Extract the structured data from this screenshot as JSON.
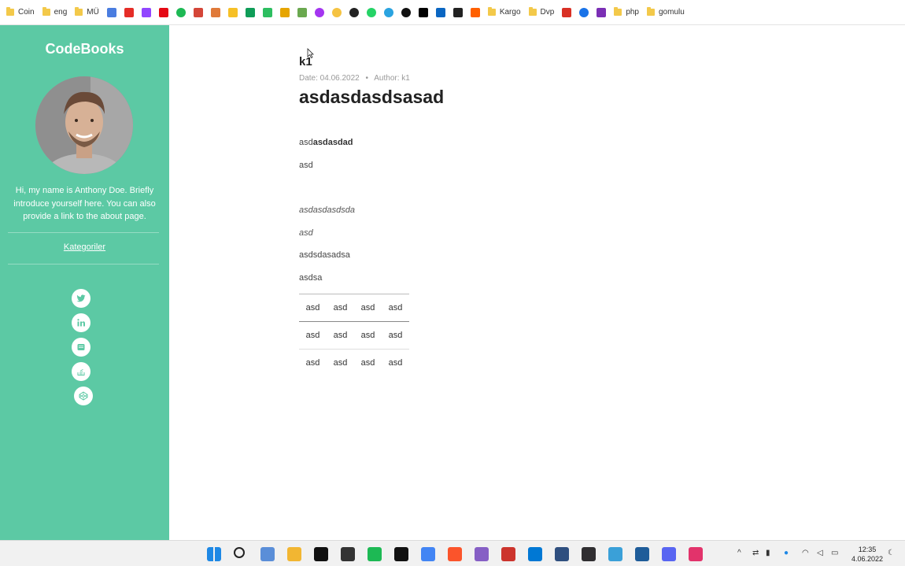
{
  "bookmarks": [
    {
      "label": "Coin",
      "type": "folder"
    },
    {
      "label": "eng",
      "type": "folder"
    },
    {
      "label": "MÜ",
      "type": "folder"
    },
    {
      "label": "",
      "type": "icon",
      "icon": "translate-icon",
      "color": "#4a7de0"
    },
    {
      "label": "",
      "type": "icon",
      "icon": "youtube-icon",
      "color": "#e52d27"
    },
    {
      "label": "",
      "type": "icon",
      "icon": "twitch-icon",
      "color": "#9146ff"
    },
    {
      "label": "",
      "type": "icon",
      "icon": "netflix-icon",
      "color": "#e50914"
    },
    {
      "label": "",
      "type": "icon",
      "icon": "spotify-icon",
      "color": "#1db954"
    },
    {
      "label": "",
      "type": "icon",
      "icon": "gmail-icon",
      "color": "#d44638"
    },
    {
      "label": "",
      "type": "icon",
      "icon": "bookmark-icon",
      "color": "#e07a3a"
    },
    {
      "label": "",
      "type": "icon",
      "icon": "keep-icon",
      "color": "#f6c026"
    },
    {
      "label": "",
      "type": "icon",
      "icon": "sheets-icon",
      "color": "#0f9d58"
    },
    {
      "label": "",
      "type": "icon",
      "icon": "evernote-icon",
      "color": "#2dbe60"
    },
    {
      "label": "",
      "type": "icon",
      "icon": "app-icon",
      "color": "#e6a500"
    },
    {
      "label": "",
      "type": "icon",
      "icon": "photos-icon",
      "color": "#6aa84f"
    },
    {
      "label": "",
      "type": "icon",
      "icon": "udemy-icon",
      "color": "#a435f0"
    },
    {
      "label": "",
      "type": "icon",
      "icon": "circle-icon",
      "color": "#f5c342"
    },
    {
      "label": "",
      "type": "icon",
      "icon": "github-icon",
      "color": "#222222"
    },
    {
      "label": "",
      "type": "icon",
      "icon": "whatsapp-icon",
      "color": "#25d366"
    },
    {
      "label": "",
      "type": "icon",
      "icon": "telegram-icon",
      "color": "#2aa3e0"
    },
    {
      "label": "",
      "type": "icon",
      "icon": "threads-icon",
      "color": "#111111"
    },
    {
      "label": "",
      "type": "icon",
      "icon": "medium-icon",
      "color": "#000000"
    },
    {
      "label": "",
      "type": "icon",
      "icon": "linkedin-icon",
      "color": "#0a66c2"
    },
    {
      "label": "",
      "type": "icon",
      "icon": "amazon-icon",
      "color": "#222222"
    },
    {
      "label": "",
      "type": "icon",
      "icon": "hepsiburada-icon",
      "color": "#ff6000"
    },
    {
      "label": "Kargo",
      "type": "folder"
    },
    {
      "label": "Dvp",
      "type": "folder"
    },
    {
      "label": "",
      "type": "icon",
      "icon": "gmail-red-icon",
      "color": "#d93025"
    },
    {
      "label": "",
      "type": "icon",
      "icon": "play-icon",
      "color": "#1a73e8"
    },
    {
      "label": "",
      "type": "icon",
      "icon": "k-icon",
      "color": "#7b2fb5"
    },
    {
      "label": "php",
      "type": "folder"
    },
    {
      "label": "gomulu",
      "type": "folder"
    }
  ],
  "sidebar": {
    "brand": "CodeBooks",
    "intro": "Hi, my name is Anthony Doe. Briefly introduce yourself here. You can also provide a link to the about page.",
    "category_link": "Kategoriler",
    "accent": "#5cc9a4",
    "social": [
      {
        "name": "twitter-icon"
      },
      {
        "name": "linkedin-icon"
      },
      {
        "name": "github-icon"
      },
      {
        "name": "stack-overflow-icon"
      },
      {
        "name": "codepen-icon"
      }
    ]
  },
  "post": {
    "author_heading": "k1",
    "meta_date": "Date: 04.06.2022",
    "meta_sep": "•",
    "meta_author": "Author: k1",
    "title": "asdasdasdsasad",
    "p1_plain": "asd",
    "p1_bold": "asdasdad",
    "p2": "asd",
    "p3_plain": "asd",
    "p3_italic": "asdasdsda",
    "p4_italic": "asd",
    "p5": "asdsdasadsa",
    "p6": "asdsa",
    "table": [
      [
        "asd",
        "asd",
        "asd",
        "asd"
      ],
      [
        "asd",
        "asd",
        "asd",
        "asd"
      ],
      [
        "asd",
        "asd",
        "asd",
        "asd"
      ]
    ]
  },
  "taskbar": {
    "icons": [
      {
        "name": "windows-start-icon",
        "color": "#1e88e5"
      },
      {
        "name": "search-icon",
        "color": "#222222"
      },
      {
        "name": "widgets-icon",
        "color": "#5a8ed8"
      },
      {
        "name": "file-explorer-icon",
        "color": "#f2b632"
      },
      {
        "name": "terminal-icon",
        "color": "#111111"
      },
      {
        "name": "media-player-icon",
        "color": "#333333"
      },
      {
        "name": "spotify-icon",
        "color": "#1db954"
      },
      {
        "name": "notion-icon",
        "color": "#111111"
      },
      {
        "name": "chrome-icon",
        "color": "#4285f4"
      },
      {
        "name": "brave-icon",
        "color": "#fb542b"
      },
      {
        "name": "visual-studio-icon",
        "color": "#865fc5"
      },
      {
        "name": "ruby-icon",
        "color": "#cc342d"
      },
      {
        "name": "vscode-icon",
        "color": "#0078d4"
      },
      {
        "name": "dev-icon",
        "color": "#2f4f7f"
      },
      {
        "name": "obs-icon",
        "color": "#302e31"
      },
      {
        "name": "snipping-icon",
        "color": "#3aa0d8"
      },
      {
        "name": "virtualbox-icon",
        "color": "#1e5c99"
      },
      {
        "name": "discord-icon",
        "color": "#5865f2"
      },
      {
        "name": "color-picker-icon",
        "color": "#e2336b"
      }
    ],
    "time": "12:35",
    "date": "4.06.2022"
  }
}
